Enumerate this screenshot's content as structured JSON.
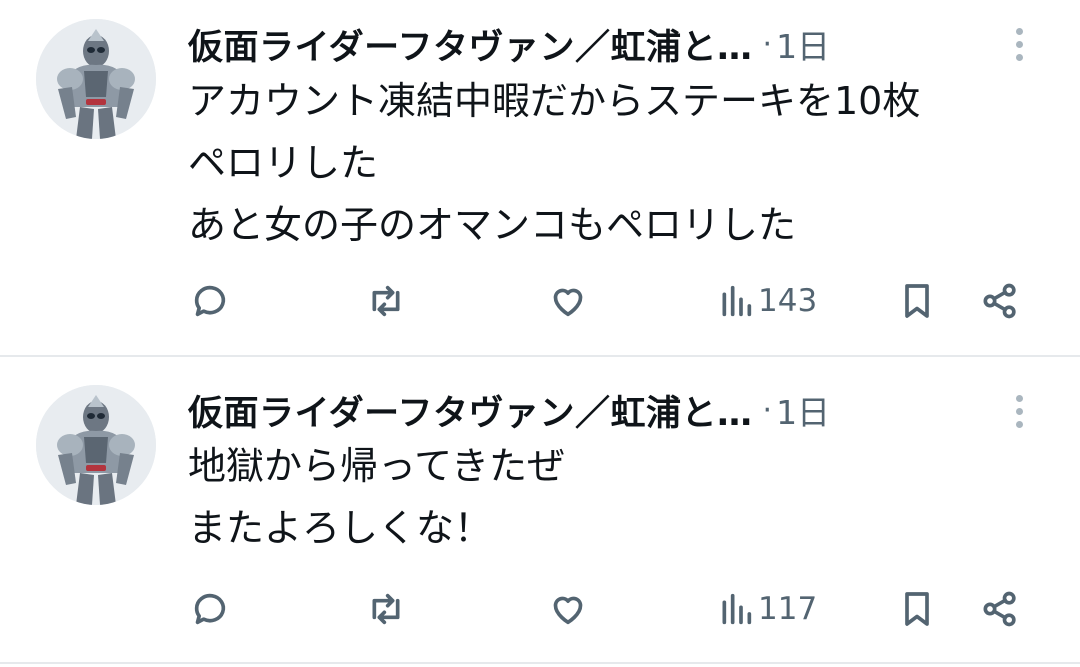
{
  "icons": {
    "avatar": "armored-rider-avatar",
    "more": "more-vertical-icon",
    "reply": "reply-icon",
    "retweet": "retweet-icon",
    "like": "heart-icon",
    "views": "views-bar-chart-icon",
    "bookmark": "bookmark-icon",
    "share": "share-icon"
  },
  "colors": {
    "text": "#0f1419",
    "secondary": "#536471",
    "divider": "#e6e9ec"
  },
  "tweets": [
    {
      "author": "仮面ライダーフタヴァン／虹浦と…",
      "dot": "·",
      "time": "1日",
      "lines": [
        "アカウント凍結中暇だからステーキを10枚",
        "ペロリした",
        "あと女の子のオマンコもペロリした"
      ],
      "views": "143"
    },
    {
      "author": "仮面ライダーフタヴァン／虹浦と…",
      "dot": "·",
      "time": "1日",
      "lines": [
        "地獄から帰ってきたぜ",
        "またよろしくな！"
      ],
      "views": "117"
    }
  ]
}
